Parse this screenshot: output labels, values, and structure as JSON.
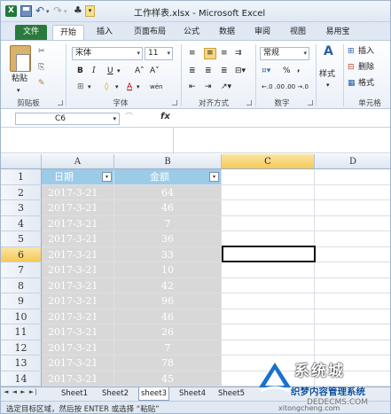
{
  "title_bar": {
    "title": "工作样表.xlsx - Microsoft Excel",
    "app_icon_letter": "X"
  },
  "ribbon_tabs": [
    "文件",
    "开始",
    "插入",
    "页面布局",
    "公式",
    "数据",
    "审阅",
    "视图",
    "易用宝"
  ],
  "ribbon": {
    "clipboard": {
      "paste_label": "粘贴",
      "group_label": "剪贴板"
    },
    "font": {
      "font_name": "宋体",
      "font_size": "11",
      "bold": "B",
      "italic": "I",
      "underline": "U",
      "grow": "A˄",
      "shrink": "A˅",
      "wen": "wén",
      "group_label": "字体"
    },
    "alignment": {
      "group_label": "对齐方式"
    },
    "number": {
      "format": "常规",
      "percent": "%",
      "comma": ",",
      "inc": "←.0 .00",
      "dec": ".00 →.0",
      "group_label": "数字"
    },
    "styles": {
      "label": "样式",
      "icon": "A"
    },
    "cells": {
      "insert": "插入",
      "delete": "删除",
      "format": "格式",
      "group_label": "单元格"
    }
  },
  "formula_bar": {
    "name_box": "C6",
    "fx_label": "fx",
    "formula": ""
  },
  "columns": [
    "A",
    "B",
    "C",
    "D"
  ],
  "rows": [
    "1",
    "2",
    "3",
    "4",
    "5",
    "6",
    "7",
    "8",
    "9",
    "10",
    "11",
    "12",
    "13",
    "14"
  ],
  "selected_row": "6",
  "selected_column": "C",
  "header_row": {
    "a": "日期",
    "b": "金额"
  },
  "data_rows": [
    {
      "date": "2017-3-21",
      "amount": "64"
    },
    {
      "date": "2017-3-21",
      "amount": "46"
    },
    {
      "date": "2017-3-21",
      "amount": "7"
    },
    {
      "date": "2017-3-21",
      "amount": "36"
    },
    {
      "date": "2017-3-21",
      "amount": "33"
    },
    {
      "date": "2017-3-21",
      "amount": "10"
    },
    {
      "date": "2017-3-21",
      "amount": "42"
    },
    {
      "date": "2017-3-21",
      "amount": "96"
    },
    {
      "date": "2017-3-21",
      "amount": "46"
    },
    {
      "date": "2017-3-21",
      "amount": "26"
    },
    {
      "date": "2017-3-21",
      "amount": "7"
    },
    {
      "date": "2017-3-21",
      "amount": "78"
    },
    {
      "date": "2017-3-21",
      "amount": "45"
    }
  ],
  "sheet_nav": "◄ ◄ ► ►|",
  "sheet_tabs": [
    "Sheet1",
    "Sheet2",
    "sheet3",
    "Sheet4",
    "Sheet5"
  ],
  "active_sheet": "sheet3",
  "status_bar": {
    "message": "选定目标区域，然后按 ENTER 或选择 “粘贴”"
  },
  "watermark": {
    "name": "系统城",
    "line1": "织梦内容管理系统",
    "line2": "DEDECMS.COM",
    "url": "xitongcheng.com"
  },
  "colors": {
    "header_fill": "#9ccbe8",
    "data_fill": "#d8d8d8",
    "selected_header": "#f5c957",
    "file_tab": "#2b7a3d"
  }
}
